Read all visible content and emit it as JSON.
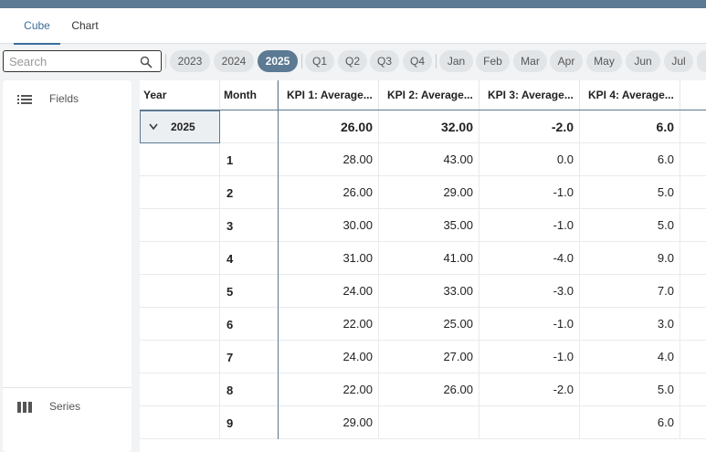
{
  "tabs": [
    {
      "label": "Cube",
      "active": true
    },
    {
      "label": "Chart",
      "active": false
    }
  ],
  "search": {
    "placeholder": "Search",
    "value": ""
  },
  "filters": {
    "years": [
      {
        "label": "2023",
        "active": false
      },
      {
        "label": "2024",
        "active": false
      },
      {
        "label": "2025",
        "active": true
      }
    ],
    "quarters": [
      "Q1",
      "Q2",
      "Q3",
      "Q4"
    ],
    "months": [
      "Jan",
      "Feb",
      "Mar",
      "Apr",
      "May",
      "Jun",
      "Jul"
    ]
  },
  "sidebar": {
    "items": [
      {
        "label": "Fields",
        "icon": "list-icon"
      },
      {
        "label": "Series",
        "icon": "columns-icon"
      }
    ]
  },
  "grid": {
    "headers": [
      "Year",
      "Month",
      "KPI 1: Average...",
      "KPI 2: Average...",
      "KPI 3: Average...",
      "KPI 4: Average..."
    ],
    "total_row": {
      "year": "2025",
      "values": [
        "26.00",
        "32.00",
        "-2.0",
        "6.0"
      ]
    },
    "rows": [
      {
        "month": "1",
        "values": [
          "28.00",
          "43.00",
          "0.0",
          "6.0"
        ]
      },
      {
        "month": "2",
        "values": [
          "26.00",
          "29.00",
          "-1.0",
          "5.0"
        ]
      },
      {
        "month": "3",
        "values": [
          "30.00",
          "35.00",
          "-1.0",
          "5.0"
        ]
      },
      {
        "month": "4",
        "values": [
          "31.00",
          "41.00",
          "-4.0",
          "9.0"
        ]
      },
      {
        "month": "5",
        "values": [
          "24.00",
          "33.00",
          "-3.0",
          "7.0"
        ]
      },
      {
        "month": "6",
        "values": [
          "22.00",
          "25.00",
          "-1.0",
          "3.0"
        ]
      },
      {
        "month": "7",
        "values": [
          "24.00",
          "27.00",
          "-1.0",
          "4.0"
        ]
      },
      {
        "month": "8",
        "values": [
          "22.00",
          "26.00",
          "-2.0",
          "5.0"
        ]
      },
      {
        "month": "9",
        "values": [
          "29.00",
          "",
          "",
          "6.0"
        ]
      }
    ]
  },
  "colors": {
    "accent": "#5c7a93",
    "tab_active": "#3a6d9a"
  }
}
